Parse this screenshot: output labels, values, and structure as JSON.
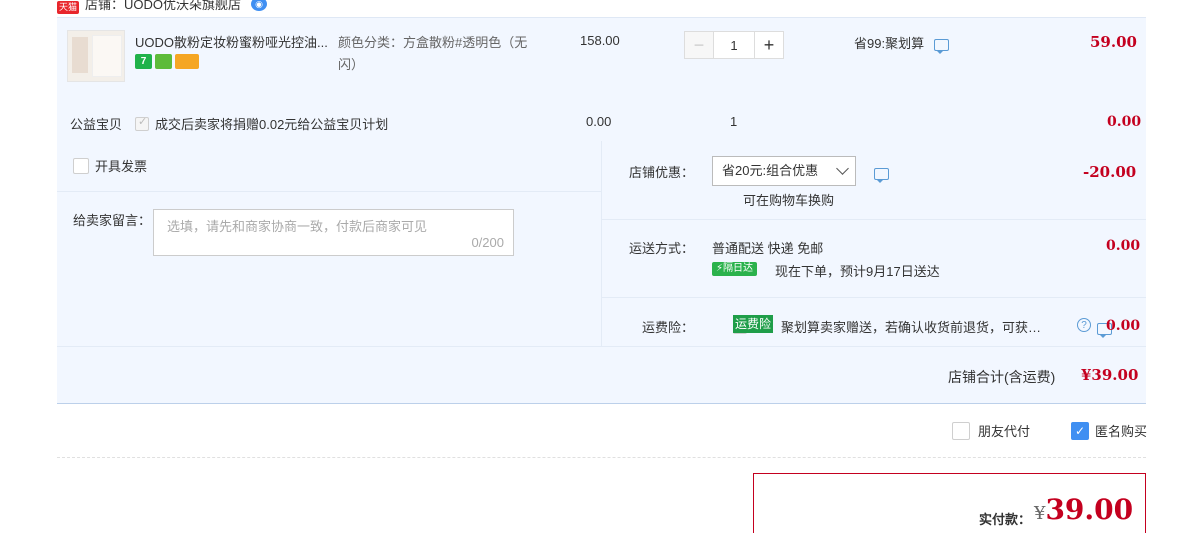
{
  "shop": {
    "badge": "天猫",
    "name": "店铺：UODO优沃朵旗舰店",
    "chat_icon": "wangwang-chat-icon"
  },
  "product": {
    "title": "UODO散粉定妆粉蜜粉哑光控油...",
    "spec": "颜色分类：方盒散粉#透明色（无闪）",
    "unit_price": "158.00",
    "quantity": "1",
    "minus": "−",
    "plus": "+",
    "promotion": "省99:聚划算",
    "subtotal": "59.00",
    "service_icons": [
      "seven-day-return-icon",
      "guarantee-icon",
      "card-icon"
    ]
  },
  "charity": {
    "label": "公益宝贝",
    "text": "成交后卖家将捐赠0.02元给公益宝贝计划",
    "price": "0.00",
    "quantity": "1",
    "total": "0.00"
  },
  "invoice": {
    "label": "开具发票",
    "checked": false
  },
  "message": {
    "label": "给卖家留言：",
    "placeholder": "选填，请先和商家协商一致，付款后商家可见",
    "counter": "0/200"
  },
  "shop_discount": {
    "label": "店铺优惠：",
    "selected": "省20元:组合优惠",
    "note": "可在购物车换购",
    "amount": "-20.00"
  },
  "shipping": {
    "label": "运送方式：",
    "method": "普通配送 快递 免邮",
    "badge": "隔日达",
    "eta": "现在下单，预计9月17日送达",
    "amount": "0.00"
  },
  "insurance": {
    "label": "运费险：",
    "badge": "运费险",
    "text": "聚划算卖家赠送，若确认收货前退货，可获…",
    "help": "?",
    "amount": "0.00"
  },
  "shop_total": {
    "label": "店铺合计(含运费)",
    "amount": "¥39.00"
  },
  "options": {
    "friend_pay": "朋友代付",
    "friend_pay_checked": false,
    "anonymous": "匿名购买",
    "anonymous_checked": true
  },
  "payment": {
    "label": "实付款：",
    "currency": "¥",
    "amount": "39.00"
  },
  "colors": {
    "accent_red": "#c4001f",
    "panel_bg": "#f2f7ff",
    "check_blue": "#3f8ff2",
    "badge_green": "#2bb24c"
  }
}
